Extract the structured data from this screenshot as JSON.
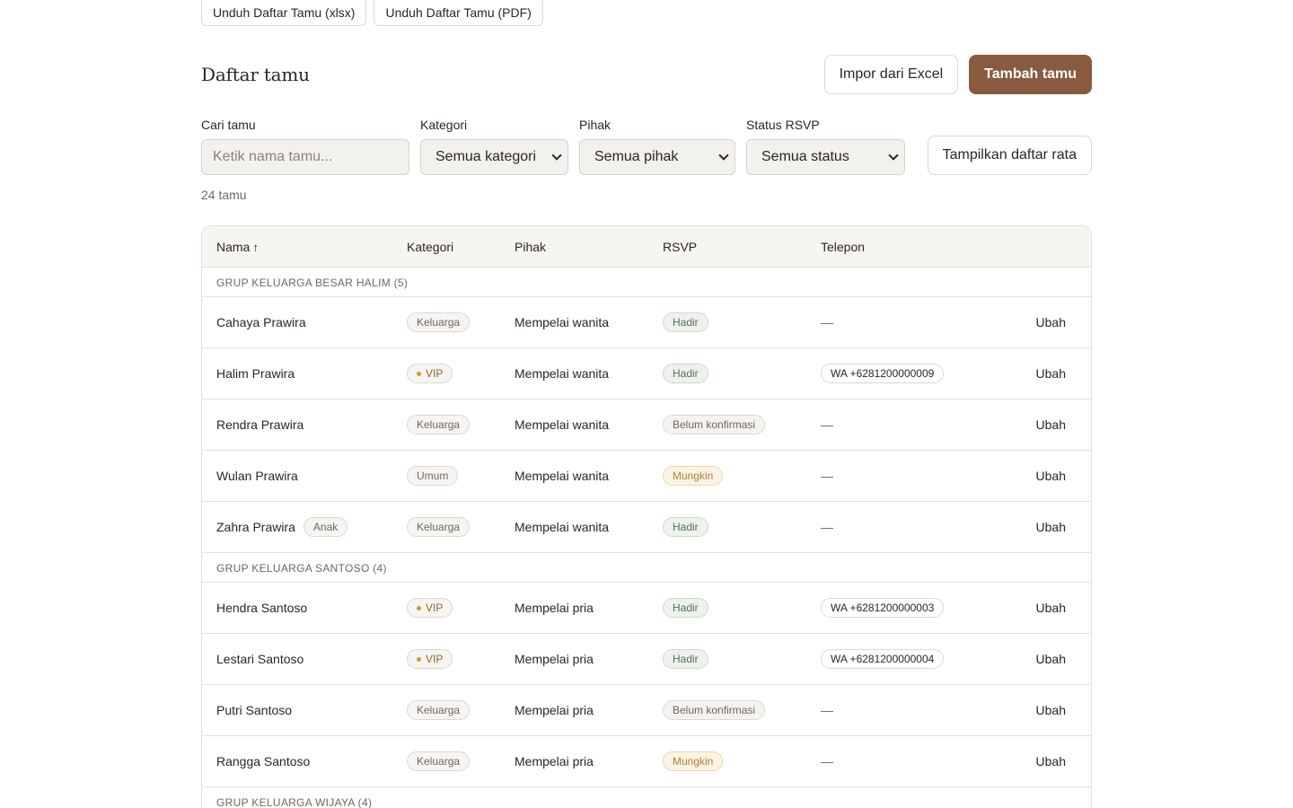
{
  "downloads": {
    "xlsx_label": "Unduh Daftar Tamu (xlsx)",
    "pdf_label": "Unduh Daftar Tamu (PDF)"
  },
  "header": {
    "title": "Daftar tamu",
    "import_label": "Impor dari Excel",
    "add_label": "Tambah tamu"
  },
  "filters": {
    "search": {
      "label": "Cari tamu",
      "placeholder": "Ketik nama tamu..."
    },
    "kategori": {
      "label": "Kategori",
      "value": "Semua kategori"
    },
    "pihak": {
      "label": "Pihak",
      "value": "Semua pihak"
    },
    "status": {
      "label": "Status RSVP",
      "value": "Semua status"
    },
    "flat_label": "Tampilkan daftar rata"
  },
  "count_text": "24 tamu",
  "table": {
    "columns": {
      "nama": "Nama",
      "sort_arrow": "↑",
      "kategori": "Kategori",
      "pihak": "Pihak",
      "rsvp": "RSVP",
      "telepon": "Telepon"
    },
    "edit_label": "Ubah",
    "groups": [
      {
        "label": "GRUP KELUARGA BESAR HALIM (5)",
        "rows": [
          {
            "name": "Cahaya Prawira",
            "tag": "",
            "kategori": "Keluarga",
            "pihak": "Mempelai wanita",
            "rsvp": "Hadir",
            "rsvp_kind": "hadir",
            "telepon": "—"
          },
          {
            "name": "Halim Prawira",
            "tag": "",
            "kategori": "VIP",
            "pihak": "Mempelai wanita",
            "rsvp": "Hadir",
            "rsvp_kind": "hadir",
            "telepon": "WA +6281200000009"
          },
          {
            "name": "Rendra Prawira",
            "tag": "",
            "kategori": "Keluarga",
            "pihak": "Mempelai wanita",
            "rsvp": "Belum konfirmasi",
            "rsvp_kind": "belum",
            "telepon": "—"
          },
          {
            "name": "Wulan Prawira",
            "tag": "",
            "kategori": "Umum",
            "pihak": "Mempelai wanita",
            "rsvp": "Mungkin",
            "rsvp_kind": "mungkin",
            "telepon": "—"
          },
          {
            "name": "Zahra Prawira",
            "tag": "Anak",
            "kategori": "Keluarga",
            "pihak": "Mempelai wanita",
            "rsvp": "Hadir",
            "rsvp_kind": "hadir",
            "telepon": "—"
          }
        ]
      },
      {
        "label": "GRUP KELUARGA SANTOSO (4)",
        "rows": [
          {
            "name": "Hendra Santoso",
            "tag": "",
            "kategori": "VIP",
            "pihak": "Mempelai pria",
            "rsvp": "Hadir",
            "rsvp_kind": "hadir",
            "telepon": "WA +6281200000003"
          },
          {
            "name": "Lestari Santoso",
            "tag": "",
            "kategori": "VIP",
            "pihak": "Mempelai pria",
            "rsvp": "Hadir",
            "rsvp_kind": "hadir",
            "telepon": "WA +6281200000004"
          },
          {
            "name": "Putri Santoso",
            "tag": "",
            "kategori": "Keluarga",
            "pihak": "Mempelai pria",
            "rsvp": "Belum konfirmasi",
            "rsvp_kind": "belum",
            "telepon": "—"
          },
          {
            "name": "Rangga Santoso",
            "tag": "",
            "kategori": "Keluarga",
            "pihak": "Mempelai pria",
            "rsvp": "Mungkin",
            "rsvp_kind": "mungkin",
            "telepon": "—"
          }
        ]
      },
      {
        "label": "GRUP KELUARGA WIJAYA (4)",
        "rows": []
      }
    ]
  },
  "colors": {
    "accent": "#8a5a3f",
    "hadir": "#55705a",
    "mungkin": "#b0823a",
    "vip_dot": "#d19a35"
  }
}
